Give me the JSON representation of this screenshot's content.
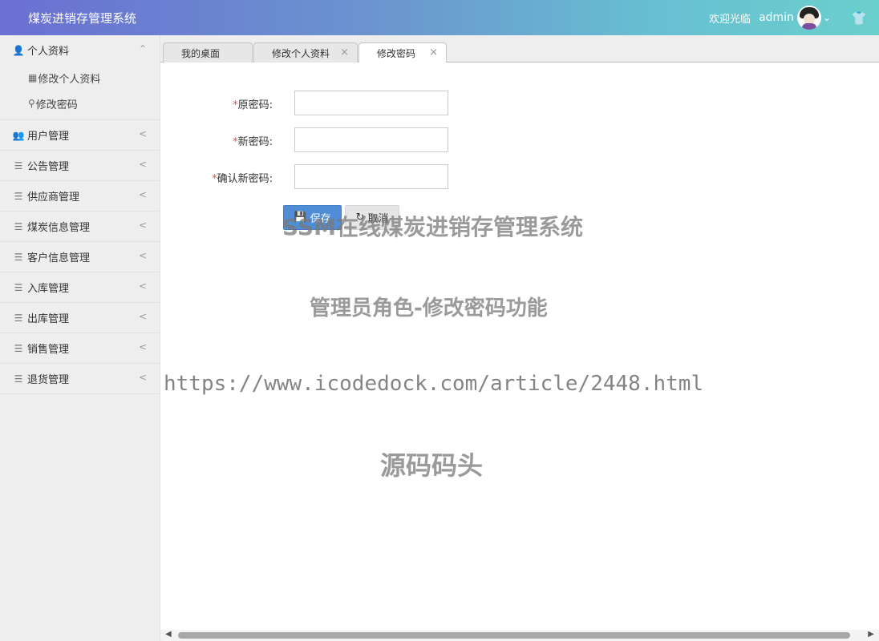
{
  "header": {
    "app_title": "煤炭进销存管理系统",
    "welcome": "欢迎光临",
    "username": "admin",
    "chevron_icon": "chevron-down-icon",
    "theme_icon": "tshirt-icon"
  },
  "sidebar": {
    "profile_group": {
      "label": "个人资料",
      "sub_items": [
        {
          "label": "修改个人资料",
          "icon": "edit-icon"
        },
        {
          "label": "修改密码",
          "icon": "key-icon"
        }
      ]
    },
    "items": [
      {
        "label": "用户管理",
        "icon": "users-icon"
      },
      {
        "label": "公告管理",
        "icon": "list-icon"
      },
      {
        "label": "供应商管理",
        "icon": "list-icon"
      },
      {
        "label": "煤炭信息管理",
        "icon": "list-icon"
      },
      {
        "label": "客户信息管理",
        "icon": "list-icon"
      },
      {
        "label": "入库管理",
        "icon": "list-icon"
      },
      {
        "label": "出库管理",
        "icon": "list-icon"
      },
      {
        "label": "销售管理",
        "icon": "list-icon"
      },
      {
        "label": "退货管理",
        "icon": "list-icon"
      }
    ]
  },
  "tabs": [
    {
      "label": "我的桌面",
      "closable": false
    },
    {
      "label": "修改个人资料",
      "closable": true
    },
    {
      "label": "修改密码",
      "closable": true,
      "active": true
    }
  ],
  "form": {
    "old_password": {
      "label": "原密码:",
      "value": ""
    },
    "new_password": {
      "label": "新密码:",
      "value": ""
    },
    "confirm_password": {
      "label": "确认新密码:",
      "value": ""
    },
    "required_mark": "*",
    "save_label": "保存",
    "cancel_label": "取消"
  },
  "watermark": {
    "line1": "SSM在线煤炭进销存管理系统",
    "line2": "管理员角色-修改密码功能",
    "line3": "https://www.icodedock.com/article/2448.html",
    "line4": "源码码头"
  },
  "colors": {
    "header_gradient_start": "#6a6fd2",
    "header_gradient_end": "#6bcfcc",
    "save_button": "#4f8dd6",
    "required": "#d9534f"
  }
}
